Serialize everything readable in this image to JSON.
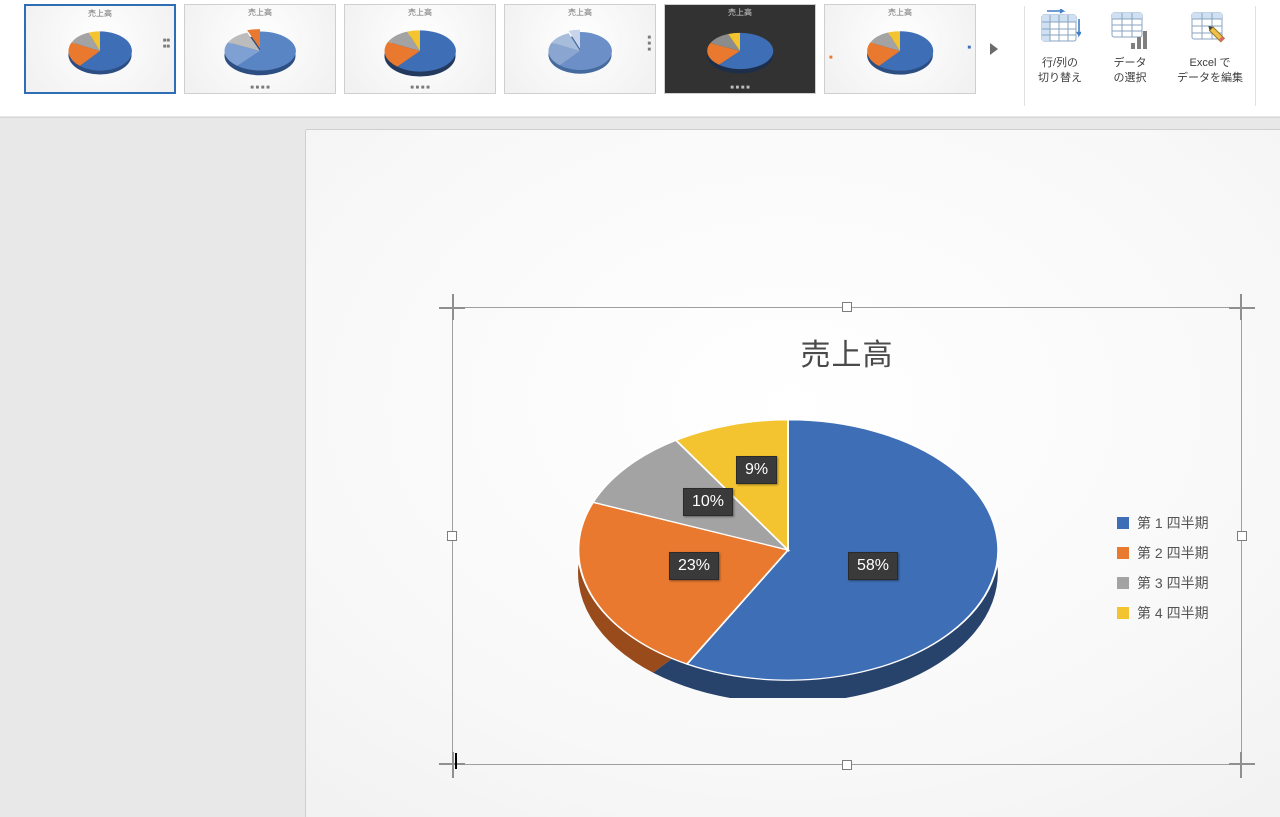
{
  "ribbon": {
    "gallery_title": "売上高",
    "buttons": {
      "switch_rowcol_l1": "行/列の",
      "switch_rowcol_l2": "切り替え",
      "select_data_l1": "データ",
      "select_data_l2": "の選択",
      "edit_excel_l1": "Excel で",
      "edit_excel_l2": "データを編集"
    }
  },
  "chart_data": {
    "type": "pie",
    "title": "売上高",
    "series": [
      {
        "name": "第 1 四半期",
        "value": 58,
        "label": "58%",
        "color": "#3e6fb6"
      },
      {
        "name": "第 2 四半期",
        "value": 23,
        "label": "23%",
        "color": "#e9792f"
      },
      {
        "name": "第 3 四半期",
        "value": 10,
        "label": "10%",
        "color": "#a3a3a3"
      },
      {
        "name": "第 4 四半期",
        "value": 9,
        "label": "9%",
        "color": "#f4c430"
      }
    ],
    "colors": {
      "q1": "#3e6fb6",
      "q1_side": "#27436c",
      "q2": "#e9792f",
      "q2_side": "#9a4b1b",
      "q3": "#a3a3a3",
      "q3_side": "#6f6f6f",
      "q4": "#f4c430",
      "q4_side": "#a8851d"
    }
  }
}
